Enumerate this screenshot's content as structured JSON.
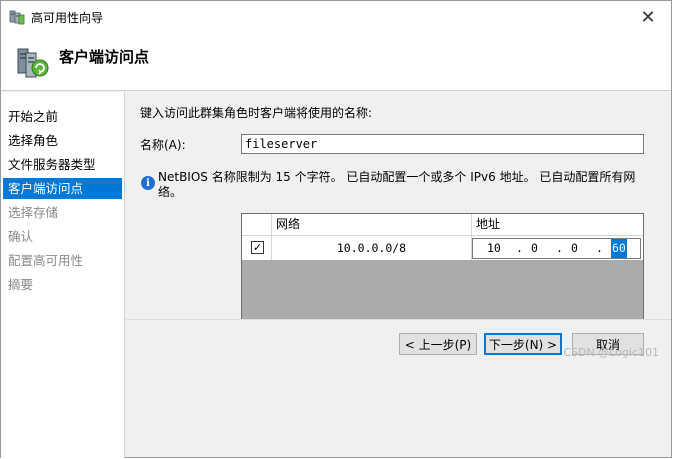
{
  "window": {
    "title": "高可用性向导",
    "close_glyph": "✕"
  },
  "header": {
    "title": "客户端访问点",
    "icon": "cluster-wizard-icon"
  },
  "sidebar": {
    "steps": [
      {
        "label": "开始之前",
        "state": "done"
      },
      {
        "label": "选择角色",
        "state": "done"
      },
      {
        "label": "文件服务器类型",
        "state": "done"
      },
      {
        "label": "客户端访问点",
        "state": "active"
      },
      {
        "label": "选择存储",
        "state": "future"
      },
      {
        "label": "确认",
        "state": "future"
      },
      {
        "label": "配置高可用性",
        "state": "future"
      },
      {
        "label": "摘要",
        "state": "future"
      }
    ]
  },
  "main": {
    "prompt": "键入访问此群集角色时客户端将使用的名称:",
    "name_label": "名称(A):",
    "name_value": "fileserver",
    "info": "NetBIOS 名称限制为 15 个字符。 已自动配置一个或多个 IPv6 地址。 已自动配置所有网络。",
    "grid": {
      "col_network": "网络",
      "col_address": "地址",
      "rows": [
        {
          "checked": true,
          "check_glyph": "✓",
          "network": "10.0.0.0/8",
          "octets": [
            "10",
            "0",
            "0",
            "60"
          ]
        }
      ]
    }
  },
  "footer": {
    "back_label": "< 上一步(P)",
    "next_label": "下一步(N) >",
    "cancel_label": "取消",
    "watermark": "CSDN @Logic101"
  },
  "colors": {
    "accent": "#0078d7",
    "grid_empty": "#ababab"
  }
}
